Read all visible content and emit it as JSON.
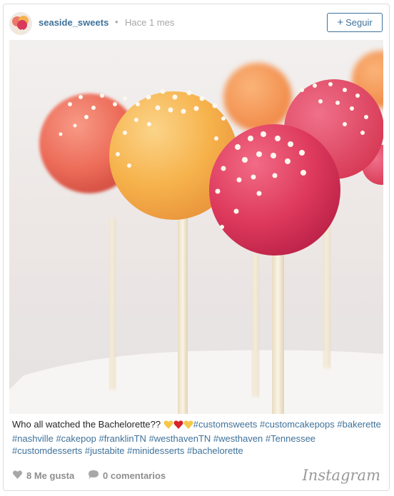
{
  "header": {
    "username": "seaside_sweets",
    "separator": "•",
    "time_ago": "Hace 1 mes",
    "follow_label": "Seguir"
  },
  "icons": [
    "avatar",
    "user-tag-icon",
    "heart-icon",
    "comment-icon",
    "instagram-logo"
  ],
  "caption": {
    "text": "Who all watched the Bachelorette??",
    "emojis": [
      "yellow-heart",
      "red-heart",
      "yellow-heart"
    ],
    "hashtags": [
      "#customsweets",
      "#customcakepops",
      "#bakerette",
      "#nashville",
      "#cakepop",
      "#franklinTN",
      "#westhavenTN",
      "#westhaven",
      "#Tennessee",
      "#customdesserts",
      "#justabite",
      "#minidesserts",
      "#bachelorette"
    ]
  },
  "footer": {
    "likes": "8 Me gusta",
    "comments": "0 comentarios",
    "brand": "Instagram"
  },
  "colors": {
    "link": "#3f729b",
    "muted": "#a5a7aa",
    "cakepop_coral": "#ef6f5c",
    "cakepop_yellow": "#f7b24a",
    "cakepop_pink": "#e03a5e",
    "cakepop_orange": "#f59a4f"
  }
}
